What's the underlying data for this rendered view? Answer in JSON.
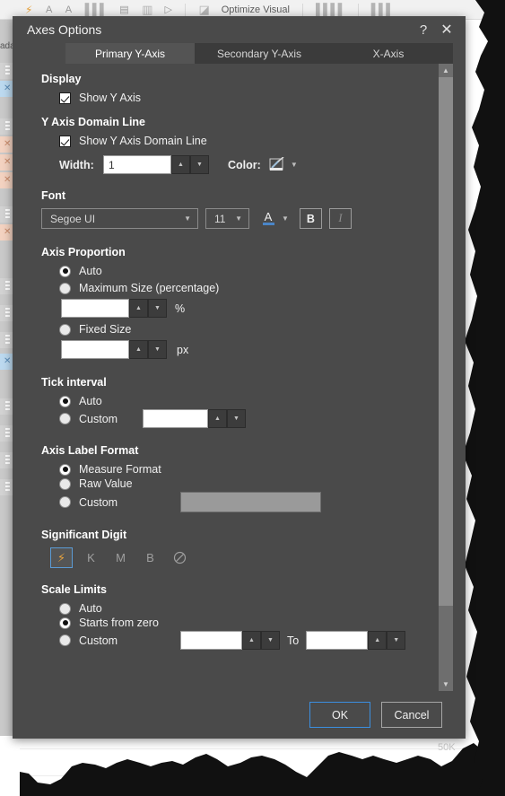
{
  "background": {
    "ribbon": {
      "optimize_label": "Optimize Visual",
      "icon_bolt": "bolt-icon",
      "icon_font_grow": "A",
      "icon_font_shrink": "A",
      "icon_chart": "chart-icon",
      "icon_table": "table-icon",
      "icon_settings": "chart-settings-icon",
      "icon_play": "play-icon",
      "icon_analyze": "analyze-icon"
    },
    "rail_label": "ada",
    "chart_axis_label": "50K"
  },
  "dialog": {
    "title": "Axes Options",
    "help_icon": "?",
    "close_icon": "✕",
    "tabs": [
      {
        "label": "Primary Y-Axis",
        "active": true
      },
      {
        "label": "Secondary Y-Axis",
        "active": false
      },
      {
        "label": "X-Axis",
        "active": false
      }
    ],
    "display": {
      "heading": "Display",
      "show_y_axis": {
        "label": "Show Y Axis",
        "checked": true
      }
    },
    "domain_line": {
      "heading": "Y Axis Domain Line",
      "show_domain_line": {
        "label": "Show Y Axis Domain Line",
        "checked": true
      },
      "width_label": "Width:",
      "width_value": "1",
      "color_label": "Color:",
      "color_icon": "pencil-color-icon"
    },
    "font": {
      "heading": "Font",
      "family": "Segoe UI",
      "size": "11",
      "color_button": "A",
      "bold_button": "B",
      "italic_button": "I"
    },
    "axis_proportion": {
      "heading": "Axis Proportion",
      "options": [
        {
          "label": "Auto",
          "selected": true
        },
        {
          "label": "Maximum Size (percentage)",
          "selected": false
        },
        {
          "label": "Fixed Size",
          "selected": false
        }
      ],
      "percent_value": "",
      "percent_unit": "%",
      "fixed_value": "",
      "fixed_unit": "px"
    },
    "tick_interval": {
      "heading": "Tick interval",
      "options": [
        {
          "label": "Auto",
          "selected": true
        },
        {
          "label": "Custom",
          "selected": false
        }
      ],
      "custom_value": ""
    },
    "axis_label_format": {
      "heading": "Axis Label Format",
      "options": [
        {
          "label": "Measure Format",
          "selected": true
        },
        {
          "label": "Raw Value",
          "selected": false
        },
        {
          "label": "Custom",
          "selected": false
        }
      ],
      "custom_value": ""
    },
    "significant_digit": {
      "heading": "Significant Digit",
      "buttons": [
        {
          "label": "⚡",
          "name": "auto",
          "active": true
        },
        {
          "label": "K",
          "name": "thousands",
          "active": false
        },
        {
          "label": "M",
          "name": "millions",
          "active": false
        },
        {
          "label": "B",
          "name": "billions",
          "active": false
        },
        {
          "label": "⃠",
          "name": "none",
          "active": false
        }
      ]
    },
    "scale_limits": {
      "heading": "Scale Limits",
      "options": [
        {
          "label": "Auto",
          "selected": false
        },
        {
          "label": "Starts from zero",
          "selected": true
        },
        {
          "label": "Custom",
          "selected": false
        }
      ],
      "from_value": "",
      "to_label": "To",
      "to_value": ""
    },
    "scrollbar": {
      "up_arrow": "▲",
      "down_arrow": "▼"
    },
    "footer": {
      "ok": "OK",
      "cancel": "Cancel"
    }
  },
  "colors": {
    "dialog_bg": "#4a4a4a",
    "tab_inactive": "#3b3b3b",
    "tab_active": "#545454",
    "accent_blue": "#3b8fe0",
    "accent_orange": "#e8a33d",
    "input_bg": "#ffffff"
  }
}
